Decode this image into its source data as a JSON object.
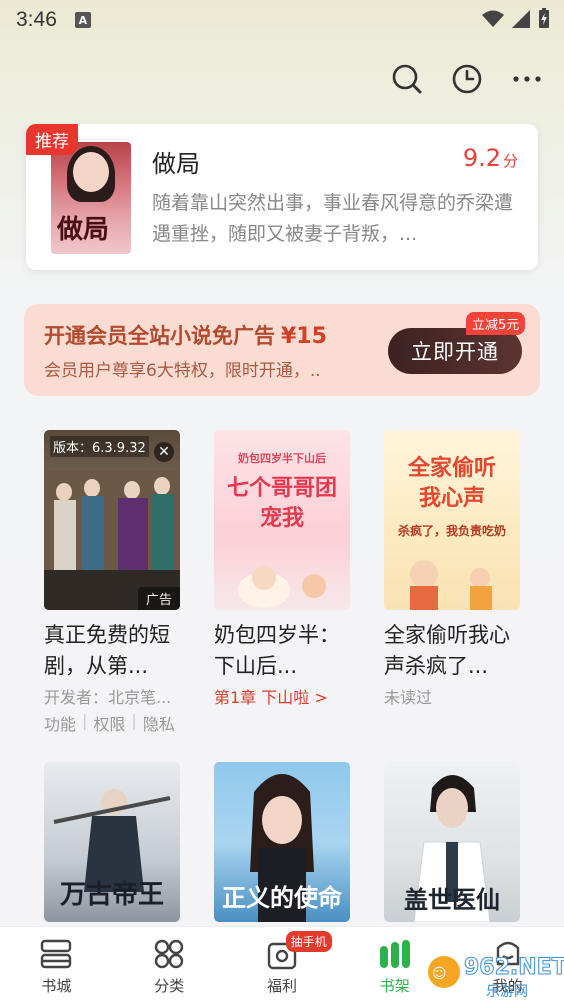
{
  "status_bar": {
    "time": "3:46",
    "notif_letter": "A"
  },
  "topbar": {
    "icons": [
      "search-icon",
      "history-icon",
      "more-icon"
    ]
  },
  "recommend": {
    "badge": "推荐",
    "cover_text": "做局",
    "title": "做局",
    "score": "9.2",
    "score_unit": "分",
    "description": "随着靠山突然出事，事业春风得意的乔梁遭遇重挫，随即又被妻子背叛，..."
  },
  "vip": {
    "title": "开通会员全站小说免广告",
    "price": "¥15",
    "subtitle": "会员用户尊享6大特权，限时开通，..",
    "button": "立即开通",
    "tag": "立减5元"
  },
  "books": [
    {
      "name": "真正免费的短剧，从第...",
      "ad_version": "版本：6.3.9.32",
      "ad_label": "广告",
      "meta": "开发者：北京笔...",
      "links": [
        "功能",
        "权限",
        "隐私"
      ]
    },
    {
      "name": "奶包四岁半：下山后...",
      "meta": "第1章 下山啦 >",
      "cover_text": "七个哥哥团宠我",
      "cover_small": "奶包四岁半下山后"
    },
    {
      "name": "全家偷听我心声杀疯了...",
      "meta": "未读过",
      "cover_text": "全家偷听我心声",
      "cover_small": "杀疯了，我负责吃奶"
    },
    {
      "cover_text": "万古帝王"
    },
    {
      "cover_text": "正义的使命"
    },
    {
      "cover_text": "盖世医仙"
    }
  ],
  "bottom_nav": {
    "items": [
      {
        "label": "书城",
        "icon": "bookstore-icon"
      },
      {
        "label": "分类",
        "icon": "category-icon"
      },
      {
        "label": "福利",
        "icon": "welfare-icon",
        "badge": "抽手机"
      },
      {
        "label": "书架",
        "icon": "bookshelf-icon"
      },
      {
        "label": "我的",
        "icon": "profile-icon"
      }
    ],
    "active": "书架"
  },
  "watermark": "962.NET 乐游网",
  "colors": {
    "accent_red": "#e5403a",
    "active_green": "#2bb34a",
    "vip_bg": "#fbdcd2"
  }
}
